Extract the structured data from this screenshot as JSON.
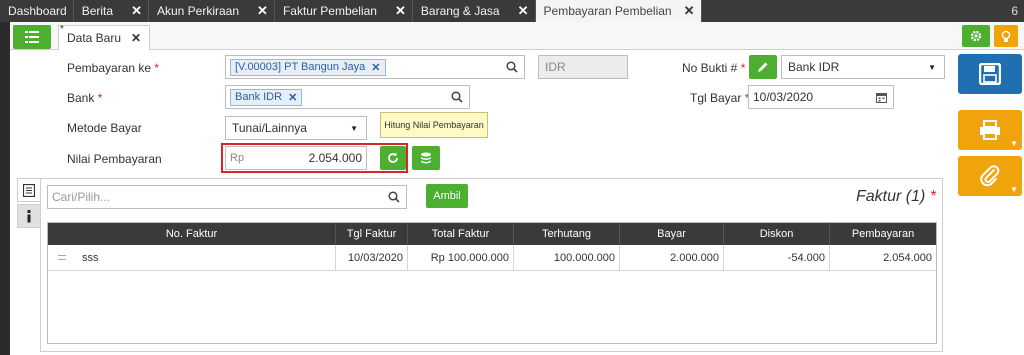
{
  "tabs": [
    {
      "label": "Dashboard",
      "closable": false
    },
    {
      "label": "Berita",
      "closable": true
    },
    {
      "label": "Akun Perkiraan",
      "closable": true
    },
    {
      "label": "Faktur Pembelian",
      "closable": true
    },
    {
      "label": "Barang & Jasa",
      "closable": true
    },
    {
      "label": "Pembayaran Pembelian",
      "closable": true,
      "active": true
    }
  ],
  "tab_count": "6",
  "subtab": {
    "marker": "*",
    "label": "Data Baru"
  },
  "form": {
    "pembayaran_ke": {
      "label": "Pembayaran ke",
      "value": "[V.00003] PT Bangun Jaya"
    },
    "currency": "IDR",
    "no_bukti": {
      "label": "No Bukti #",
      "value": "Bank IDR"
    },
    "bank": {
      "label": "Bank",
      "value": "Bank IDR"
    },
    "tgl_bayar": {
      "label": "Tgl Bayar",
      "value": "10/03/2020"
    },
    "metode_bayar": {
      "label": "Metode Bayar",
      "value": "Tunai/Lainnya"
    },
    "nilai_pembayaran": {
      "label": "Nilai Pembayaran",
      "prefix": "Rp",
      "value": "2.054.000"
    },
    "required_mark": "*"
  },
  "tooltip": "Hitung Nilai Pembayaran",
  "detail": {
    "search_placeholder": "Cari/Pilih...",
    "ambil_label": "Ambil",
    "title": "Faktur (1)",
    "title_mark": "*",
    "columns": [
      "No. Faktur",
      "Tgl Faktur",
      "Total Faktur",
      "Terhutang",
      "Bayar",
      "Diskon",
      "Pembayaran"
    ],
    "rows": [
      {
        "no_faktur": "sss",
        "tgl_faktur": "10/03/2020",
        "total_faktur": "Rp 100.000.000",
        "terhutang": "100.000.000",
        "bayar": "2.000.000",
        "diskon": "-54.000",
        "pembayaran": "2.054.000"
      }
    ]
  },
  "icons": {
    "list": "list-icon",
    "gear": "gear-icon",
    "bulb": "lightbulb-icon",
    "save": "floppy-icon",
    "print": "printer-icon",
    "attach": "paperclip-icon",
    "search": "search-icon",
    "calendar": "calendar-icon",
    "pencil": "pencil-icon",
    "refresh": "refresh-icon",
    "stack": "database-icon"
  },
  "colors": {
    "green": "#4caf2f",
    "orange": "#f0a30a",
    "blue": "#1f6fb2",
    "dark": "#3a3a3a",
    "required": "#d9232d"
  }
}
